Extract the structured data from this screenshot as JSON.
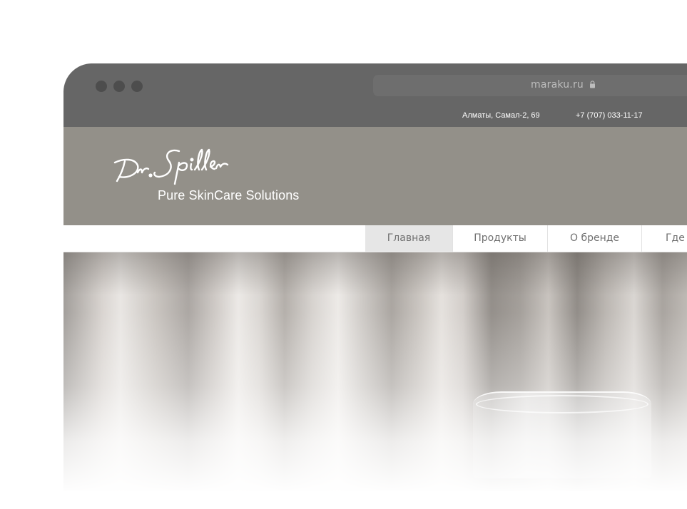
{
  "browser": {
    "url": "maraku.ru"
  },
  "topbar": {
    "address": "Алматы, Самал-2, 69",
    "phone": "+7 (707) 033-11-17"
  },
  "header": {
    "logo_text": "Dr. Spiller",
    "tagline": "Pure SkinCare Solutions"
  },
  "nav": {
    "items": [
      {
        "label": "Главная",
        "active": true
      },
      {
        "label": "Продукты",
        "active": false
      },
      {
        "label": "О бренде",
        "active": false
      },
      {
        "label": "Где к",
        "active": false
      }
    ]
  },
  "colors": {
    "chrome": "#666666",
    "header_bg": "#939089",
    "nav_active_bg": "#e6e6e6"
  }
}
